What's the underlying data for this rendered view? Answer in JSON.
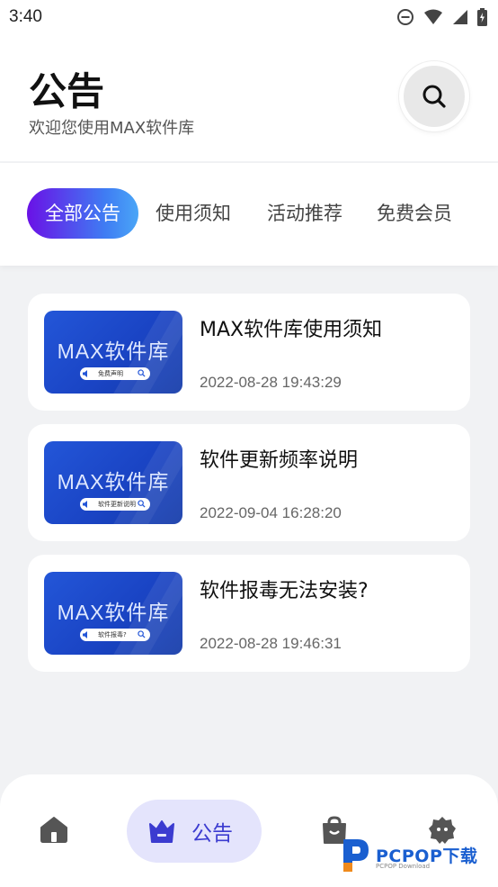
{
  "status_bar": {
    "time": "3:40"
  },
  "header": {
    "title": "公告",
    "subtitle": "欢迎您使用MAX软件库"
  },
  "tabs": [
    {
      "label": "全部公告",
      "active": true
    },
    {
      "label": "使用须知",
      "active": false
    },
    {
      "label": "活动推荐",
      "active": false
    },
    {
      "label": "免费会员",
      "active": false
    }
  ],
  "announcements": [
    {
      "title": "MAX软件库使用须知",
      "date": "2022-08-28 19:43:29",
      "thumb_title": "MAX软件库",
      "thumb_caption": "免费声明"
    },
    {
      "title": "软件更新频率说明",
      "date": "2022-09-04 16:28:20",
      "thumb_title": "MAX软件库",
      "thumb_caption": "软件更新说明"
    },
    {
      "title": "软件报毒无法安装?",
      "date": "2022-08-28 19:46:31",
      "thumb_title": "MAX软件库",
      "thumb_caption": "软件报毒?"
    }
  ],
  "bottom_nav": {
    "items": [
      {
        "icon": "home-icon"
      },
      {
        "icon": "crown-icon",
        "label": "公告",
        "active": true
      },
      {
        "icon": "shopping-bag-icon"
      },
      {
        "icon": "profile-icon"
      }
    ]
  },
  "watermark": {
    "text": "PCPOP下载",
    "sub": "PCPOP Download"
  },
  "colors": {
    "accent": "#3b3bd0",
    "tab_gradient_start": "#6a11e6",
    "tab_gradient_end": "#4aa6f7",
    "thumb_blue": "#1a44c4"
  }
}
